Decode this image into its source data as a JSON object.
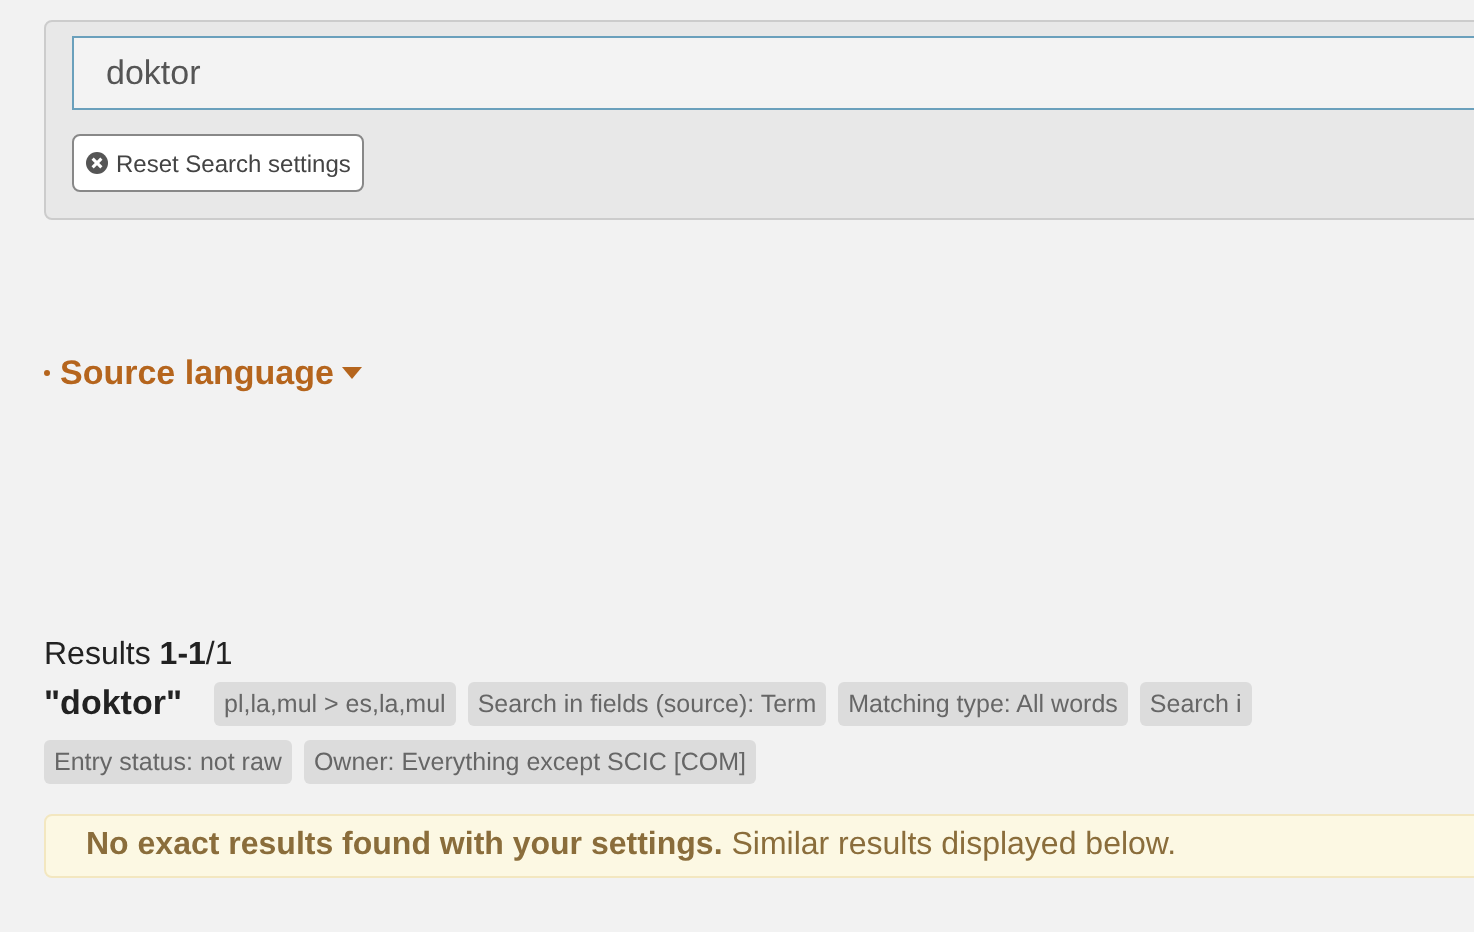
{
  "search": {
    "value": "doktor",
    "reset_button": "Reset Search settings"
  },
  "source_language": {
    "label": "Source language",
    "expanded": false
  },
  "results": {
    "summary": "Results **1-1**/1",
    "query": "\"doktor\"",
    "filters": [
      "pl,la,mul > es,la,mul",
      "Search in fields (source): Term",
      "Matching type: All words",
      "Search i",
      "Entry status: not raw",
      "Owner: Everything except SCIC [COM]"
    ],
    "notice": "**No exact results found with your settings.** Similar results displayed below."
  }
}
